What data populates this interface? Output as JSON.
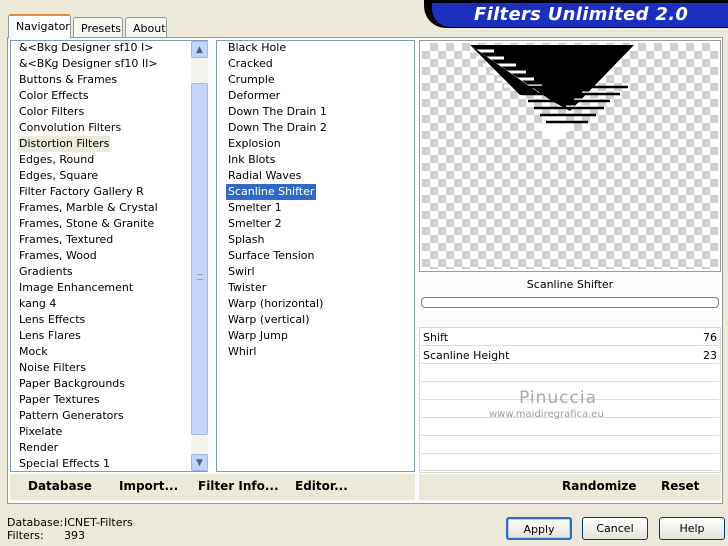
{
  "header": {
    "title": "Filters Unlimited 2.0"
  },
  "tabs": [
    {
      "label": "Navigator",
      "active": true
    },
    {
      "label": "Presets",
      "active": false
    },
    {
      "label": "About",
      "active": false
    }
  ],
  "categories": [
    "&<Bkg Designer sf10 I>",
    "&<BKg Designer sf10 II>",
    "Buttons & Frames",
    "Color Effects",
    "Color Filters",
    "Convolution Filters",
    "Distortion Filters",
    "Edges, Round",
    "Edges, Square",
    "Filter Factory Gallery R",
    "Frames, Marble & Crystal",
    "Frames, Stone & Granite",
    "Frames, Textured",
    "Frames, Wood",
    "Gradients",
    "Image Enhancement",
    "kang 4",
    "Lens Effects",
    "Lens Flares",
    "Mock",
    "Noise Filters",
    "Paper Backgrounds",
    "Paper Textures",
    "Pattern Generators",
    "Pixelate",
    "Render",
    "Special Effects 1"
  ],
  "selected_category": "Distortion Filters",
  "filters": [
    "Black Hole",
    "Cracked",
    "Crumple",
    "Deformer",
    "Down The Drain 1",
    "Down The Drain 2",
    "Explosion",
    "Ink Blots",
    "Radial Waves",
    "Scanline Shifter",
    "Smelter 1",
    "Smelter 2",
    "Splash",
    "Surface Tension",
    "Swirl",
    "Twister",
    "Warp (horizontal)",
    "Warp (vertical)",
    "Warp Jump",
    "Whirl"
  ],
  "selected_filter": "Scanline Shifter",
  "preview": {
    "filter_name": "Scanline Shifter"
  },
  "params": [
    {
      "label": "Shift",
      "value": "76"
    },
    {
      "label": "Scanline Height",
      "value": "23"
    }
  ],
  "watermark": {
    "name": "Pinuccia",
    "url": "www.maidiregrafica.eu"
  },
  "bottom_bar": {
    "database": "Database",
    "import": "Import...",
    "filter_info": "Filter Info...",
    "editor": "Editor...",
    "randomize": "Randomize",
    "reset": "Reset"
  },
  "status": {
    "database_label": "Database:",
    "database_value": "ICNET-Filters",
    "filters_label": "Filters:",
    "filters_value": "393"
  },
  "buttons": {
    "apply": "Apply",
    "cancel": "Cancel",
    "help": "Help"
  },
  "icons": {
    "scroll_up": "chevron-up-icon",
    "scroll_down": "chevron-down-icon",
    "scroll_grip": "grip-icon"
  }
}
